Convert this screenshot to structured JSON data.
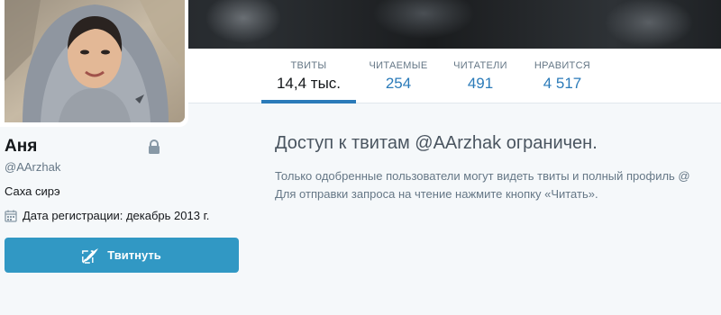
{
  "profile": {
    "name": "Аня",
    "handle": "@AArzhak",
    "bio": "Саха сирэ",
    "joined": "Дата регистрации: декабрь 2013 г."
  },
  "stats": [
    {
      "label": "ТВИТЫ",
      "value": "14,4 тыс.",
      "active": true
    },
    {
      "label": "ЧИТАЕМЫЕ",
      "value": "254",
      "active": false
    },
    {
      "label": "ЧИТАТЕЛИ",
      "value": "491",
      "active": false
    },
    {
      "label": "НРАВИТСЯ",
      "value": "4 517",
      "active": false
    }
  ],
  "actions": {
    "tweet_label": "Твитнуть"
  },
  "protected": {
    "title": "Доступ к твитам @AArzhak ограничен.",
    "line1": "Только одобренные пользователи могут видеть твиты и полный профиль @",
    "line2": "Для отправки запроса на чтение нажмите кнопку «Читать»."
  },
  "colors": {
    "accent": "#2b7bb9",
    "button": "#3198c4",
    "background": "#f5f8fa"
  },
  "icons": [
    "lock-icon",
    "calendar-icon",
    "compose-tweet-icon"
  ]
}
